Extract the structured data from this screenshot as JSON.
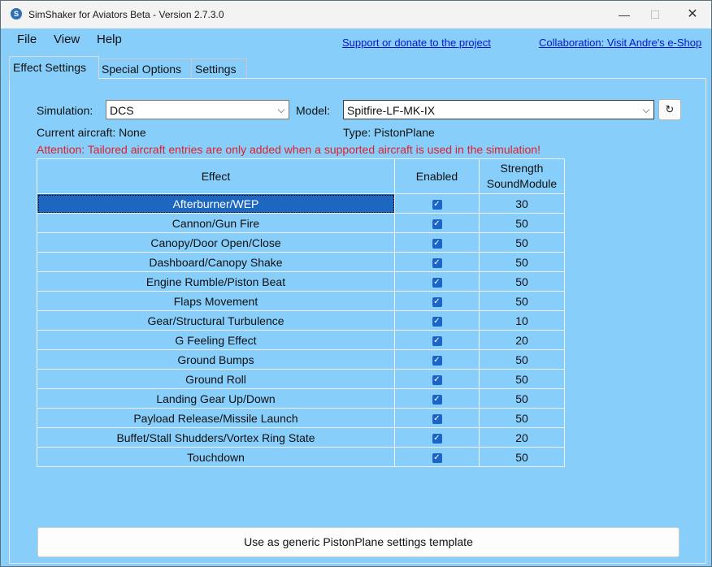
{
  "window": {
    "title": "SimShaker for Aviators Beta  - Version 2.7.3.0",
    "minimize": "—",
    "maximize": "☐",
    "close": "✕"
  },
  "menu": {
    "file": "File",
    "view": "View",
    "help": "Help"
  },
  "links": {
    "support": "Support or donate to the project",
    "collaboration": "Collaboration: Visit Andre's e-Shop"
  },
  "tabs": [
    "Effect Settings",
    "Special Options",
    "Settings"
  ],
  "form": {
    "simulation_label": "Simulation:",
    "simulation_value": "DCS",
    "model_label": "Model:",
    "model_value": "Spitfire-LF-MK-IX",
    "refresh_glyph": "↻",
    "dropdown_glyph": "⌵",
    "current_aircraft": "Current aircraft: None",
    "type": "Type: PistonPlane",
    "attention": "Attention: Tailored aircraft entries are only added when a supported aircraft is used in the simulation!"
  },
  "table": {
    "headers": {
      "effect": "Effect",
      "enabled": "Enabled",
      "strength_line1": "Strength",
      "strength_line2": "SoundModule"
    },
    "rows": [
      {
        "effect": "Afterburner/WEP",
        "enabled": true,
        "strength": "30"
      },
      {
        "effect": "Cannon/Gun Fire",
        "enabled": true,
        "strength": "50"
      },
      {
        "effect": "Canopy/Door Open/Close",
        "enabled": true,
        "strength": "50"
      },
      {
        "effect": "Dashboard/Canopy Shake",
        "enabled": true,
        "strength": "50"
      },
      {
        "effect": "Engine Rumble/Piston Beat",
        "enabled": true,
        "strength": "50"
      },
      {
        "effect": "Flaps Movement",
        "enabled": true,
        "strength": "50"
      },
      {
        "effect": "Gear/Structural Turbulence",
        "enabled": true,
        "strength": "10"
      },
      {
        "effect": "G Feeling Effect",
        "enabled": true,
        "strength": "20"
      },
      {
        "effect": "Ground Bumps",
        "enabled": true,
        "strength": "50"
      },
      {
        "effect": "Ground Roll",
        "enabled": true,
        "strength": "50"
      },
      {
        "effect": "Landing Gear Up/Down",
        "enabled": true,
        "strength": "50"
      },
      {
        "effect": "Payload Release/Missile Launch",
        "enabled": true,
        "strength": "50"
      },
      {
        "effect": "Buffet/Stall Shudders/Vortex Ring State",
        "enabled": true,
        "strength": "20"
      },
      {
        "effect": "Touchdown",
        "enabled": true,
        "strength": "50"
      }
    ],
    "checkmark": "✓"
  },
  "template_button": "Use as generic PistonPlane settings template",
  "colors": {
    "background": "#87cefa",
    "selection": "#1e67c1",
    "checkbox": "#1a65c7",
    "attention": "#e0202a",
    "link": "#0b15c9"
  }
}
